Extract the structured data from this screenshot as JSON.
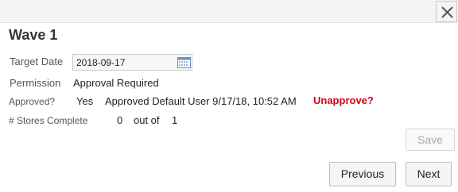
{
  "header": {
    "title": "Wave 1",
    "close_icon": "close-icon"
  },
  "form": {
    "target_date": {
      "label": "Target Date",
      "value": "2018-09-17",
      "icon": "calendar-icon"
    },
    "permission": {
      "label": "Permission",
      "value": "Approval Required"
    },
    "approved": {
      "label": "Approved?",
      "value": "Yes",
      "detail": "Approved Default User 9/17/18, 10:52 AM",
      "action": "Unapprove?",
      "action_color": "#d0021b"
    },
    "stores": {
      "label": "# Stores Complete",
      "completed": "0",
      "out_of_label": "out of",
      "total": "1"
    }
  },
  "buttons": {
    "save": "Save",
    "previous": "Previous",
    "next": "Next"
  }
}
